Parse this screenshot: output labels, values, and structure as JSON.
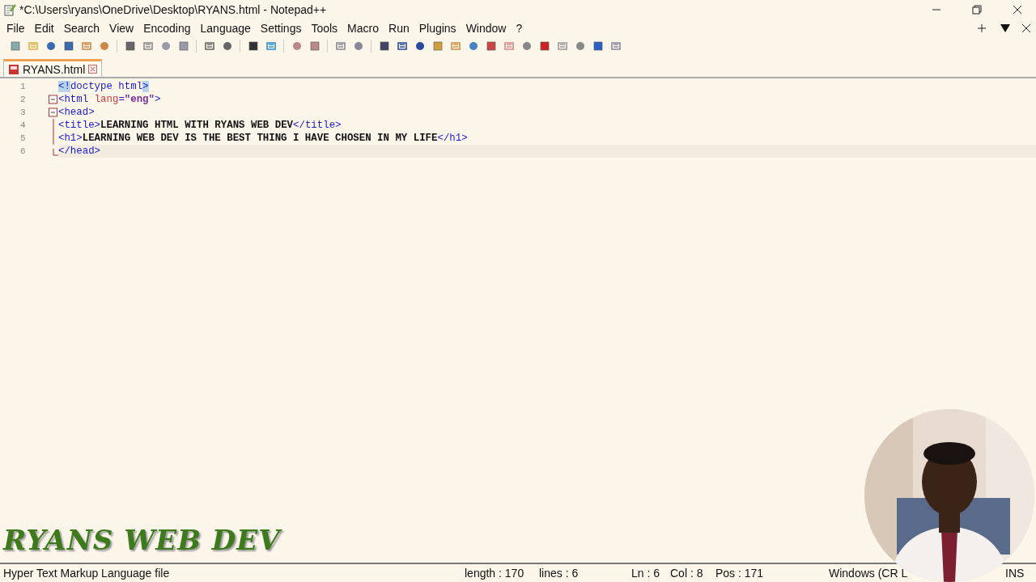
{
  "window": {
    "title": "*C:\\Users\\ryans\\OneDrive\\Desktop\\RYANS.html - Notepad++"
  },
  "menu": [
    "File",
    "Edit",
    "Search",
    "View",
    "Encoding",
    "Language",
    "Settings",
    "Tools",
    "Macro",
    "Run",
    "Plugins",
    "Window",
    "?"
  ],
  "tabs": [
    {
      "label": "RYANS.html",
      "selected": true
    }
  ],
  "editor": {
    "lines": [
      {
        "number": "1",
        "expanded": false,
        "current": false,
        "tokens": [
          {
            "kind": "brace",
            "text": "<!"
          },
          {
            "kind": "tag",
            "text": "doctype html"
          },
          {
            "kind": "brace",
            "text": ">"
          }
        ]
      },
      {
        "number": "2",
        "expanded": true,
        "current": false,
        "tokens": [
          {
            "kind": "tag",
            "text": "<html "
          },
          {
            "kind": "attr",
            "text": "lang"
          },
          {
            "kind": "tag",
            "text": "="
          },
          {
            "kind": "string",
            "text": "\"eng\""
          },
          {
            "kind": "tag",
            "text": ">"
          }
        ]
      },
      {
        "number": "3",
        "expanded": true,
        "current": false,
        "tokens": [
          {
            "kind": "tag",
            "text": "<head>"
          }
        ]
      },
      {
        "number": "4",
        "expanded": false,
        "current": false,
        "tokens": [
          {
            "kind": "tag",
            "text": "<title>"
          },
          {
            "kind": "text",
            "text": "LEARNING HTML WITH RYANS WEB DEV"
          },
          {
            "kind": "tag",
            "text": "</title>"
          }
        ]
      },
      {
        "number": "5",
        "expanded": false,
        "current": false,
        "tokens": [
          {
            "kind": "tag",
            "text": "<h1>"
          },
          {
            "kind": "text",
            "text": "LEARNING WEB DEV IS THE BEST THING I HAVE CHOSEN IN MY LIFE"
          },
          {
            "kind": "tag",
            "text": "</h1>"
          }
        ]
      },
      {
        "number": "6",
        "expanded": false,
        "current": true,
        "tokens": [
          {
            "kind": "tag",
            "text": "</head>"
          }
        ]
      }
    ]
  },
  "overlay_caption": "RYANS WEB DEV",
  "status_bar": {
    "file_type": "Hyper Text Markup Language file",
    "length": "length : 170",
    "lines": "lines : 6",
    "ln": "Ln : 6",
    "col": "Col : 8",
    "pos": "Pos : 171",
    "eol": "Windows (CR L",
    "mode": "INS"
  }
}
